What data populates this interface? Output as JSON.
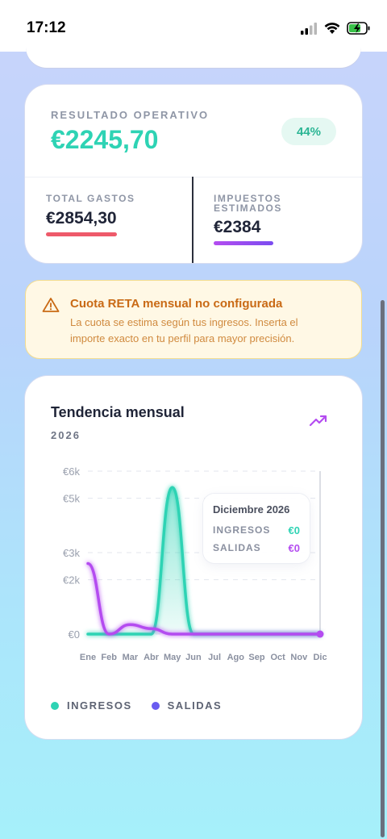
{
  "status_bar": {
    "time": "17:12"
  },
  "result_card": {
    "label": "RESULTADO OPERATIVO",
    "value": "€2245,70",
    "margin_badge": "44%",
    "total_expenses": {
      "label": "TOTAL GASTOS",
      "value": "€2854,30"
    },
    "estimated_taxes": {
      "label_line1": "IMPUESTOS",
      "label_line2": "ESTIMADOS",
      "value": "€2384"
    }
  },
  "alert": {
    "icon": "warning-icon",
    "title": "Cuota RETA mensual no configurada",
    "text_line1": "La cuota se estima según tus ingresos. Inserta el",
    "text_line2": "importe exacto en tu perfil para mayor precisión."
  },
  "trend_card": {
    "title": "Tendencia mensual",
    "year": "2026",
    "icon": "trending-up-icon",
    "tooltip": {
      "month": "Diciembre 2026",
      "income_label": "INGRESOS",
      "income_value": "€0",
      "expense_label": "SALIDAS",
      "expense_value": "€0"
    },
    "legend": [
      {
        "label": "INGRESOS",
        "color": "#2ed3b4"
      },
      {
        "label": "SALIDAS",
        "color": "#6a5cf0"
      }
    ]
  },
  "chart_data": {
    "type": "area",
    "categories": [
      "Ene",
      "Feb",
      "Mar",
      "Abr",
      "May",
      "Jun",
      "Jul",
      "Ago",
      "Sep",
      "Oct",
      "Nov",
      "Dic"
    ],
    "y_ticks": [
      "€0",
      "€2k",
      "€3k",
      "€5k",
      "€6k"
    ],
    "ylim": [
      0,
      6000
    ],
    "series": [
      {
        "name": "INGRESOS",
        "color": "#2ed3b4",
        "values": [
          0,
          0,
          0,
          0,
          5400,
          0,
          0,
          0,
          0,
          0,
          0,
          0
        ]
      },
      {
        "name": "SALIDAS",
        "color": "#b44cf0",
        "values": [
          2600,
          0,
          350,
          200,
          0,
          0,
          0,
          0,
          0,
          0,
          0,
          0
        ]
      }
    ]
  },
  "colors": {
    "accent_green": "#2ed3b4",
    "accent_purple": "#b44cf0",
    "expense_red": "#ee5a6a",
    "alert_orange": "#c96a15"
  }
}
